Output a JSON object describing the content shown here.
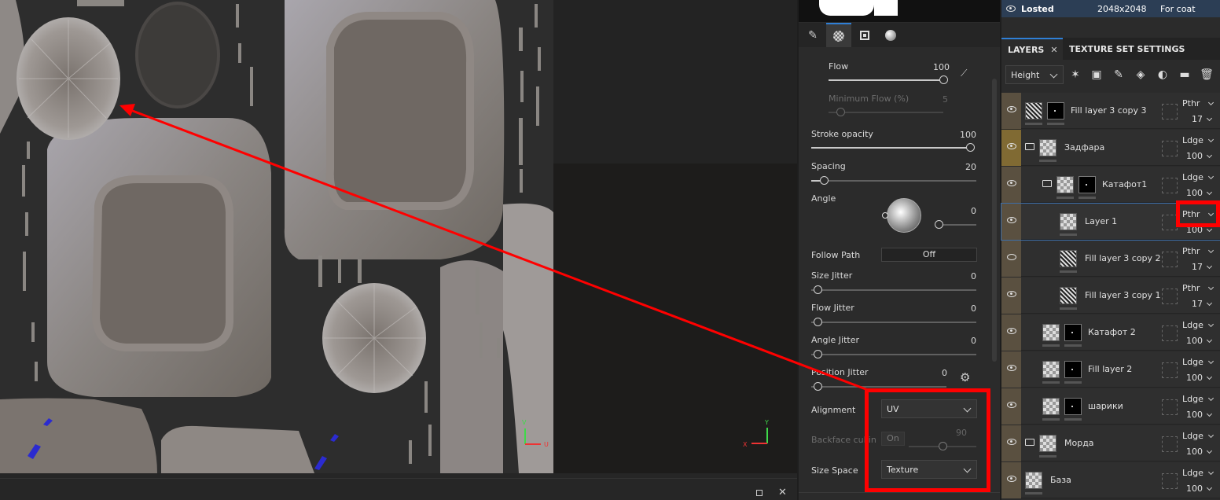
{
  "texture_set": {
    "name": "Losted",
    "resolution": "2048x2048",
    "shader": "For coat"
  },
  "layer_tabs": {
    "layers": "LAYERS",
    "texture_set_settings": "TEXTURE SET SETTINGS"
  },
  "channel_select": "Height",
  "properties": {
    "flow": {
      "label": "Flow",
      "value": "100",
      "fraction": 1.0
    },
    "min_flow": {
      "label": "Minimum Flow (%)",
      "value": "5",
      "fraction": 0.05
    },
    "stroke_opacity": {
      "label": "Stroke opacity",
      "value": "100",
      "fraction": 1.0
    },
    "spacing": {
      "label": "Spacing",
      "value": "20",
      "fraction": 0.05
    },
    "angle": {
      "label": "Angle",
      "value": "0"
    },
    "follow_path": {
      "label": "Follow Path",
      "value": "Off"
    },
    "size_jitter": {
      "label": "Size Jitter",
      "value": "0"
    },
    "flow_jitter": {
      "label": "Flow Jitter",
      "value": "0"
    },
    "angle_jitter": {
      "label": "Angle Jitter",
      "value": "0"
    },
    "position_jitter": {
      "label": "Position Jitter",
      "value": "0"
    },
    "alignment": {
      "label": "Alignment",
      "value": "UV"
    },
    "backface_culling": {
      "label": "Backface cullin",
      "toggle": "On",
      "value": "90"
    },
    "size_space": {
      "label": "Size Space",
      "value": "Texture"
    }
  },
  "layers": [
    {
      "name": "Fill layer 3 copy 3",
      "blend": "Pthr",
      "opacity": "17",
      "type": "fill"
    },
    {
      "name": "Задфара",
      "blend": "Ldge",
      "opacity": "100",
      "type": "folder"
    },
    {
      "name": "Катафот1",
      "blend": "Ldge",
      "opacity": "100",
      "type": "folder"
    },
    {
      "name": "Layer 1",
      "blend": "Pthr",
      "opacity": "100",
      "type": "paint"
    },
    {
      "name": "Fill layer 3 copy 2",
      "blend": "Pthr",
      "opacity": "17",
      "type": "fill"
    },
    {
      "name": "Fill layer 3 copy 1",
      "blend": "Pthr",
      "opacity": "17",
      "type": "fill"
    },
    {
      "name": "Катафот 2",
      "blend": "Ldge",
      "opacity": "100",
      "type": "paint"
    },
    {
      "name": "Fill layer 2",
      "blend": "Ldge",
      "opacity": "100",
      "type": "paint"
    },
    {
      "name": "шарики",
      "blend": "Ldge",
      "opacity": "100",
      "type": "paint"
    },
    {
      "name": "Морда",
      "blend": "Ldge",
      "opacity": "100",
      "type": "folder"
    },
    {
      "name": "База",
      "blend": "Ldge",
      "opacity": "100",
      "type": "paint"
    }
  ],
  "axis_labels": {
    "u": "U",
    "v": "V",
    "x": "X",
    "y": "Y"
  },
  "colors": {
    "annotation": "#ff0000",
    "accent": "#2f7fd6"
  }
}
